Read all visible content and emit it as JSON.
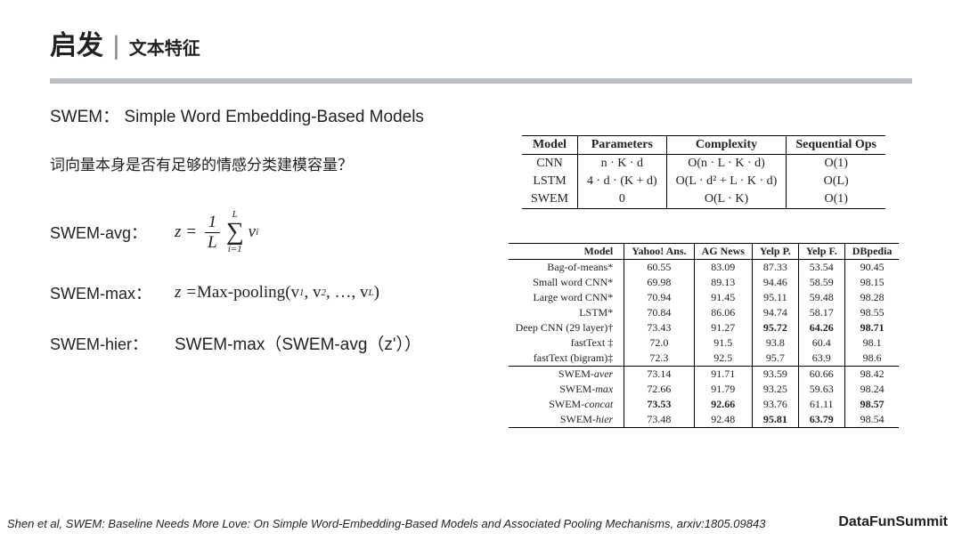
{
  "header": {
    "main": "启发",
    "separator": "|",
    "sub": "文本特征"
  },
  "swem_label": "SWEM：",
  "swem_def": "Simple Word Embedding-Based Models",
  "question": "词向量本身是否有足够的情感分类建模容量？",
  "formulas": {
    "avg": {
      "label": "SWEM-avg：",
      "z": "z",
      "eq": "=",
      "top": "1",
      "bot": "L",
      "sum_top": "L",
      "sum_bot": "i=1",
      "vi": "v",
      "visub": "i"
    },
    "max": {
      "label": "SWEM-max：",
      "text_prefix": "z = ",
      "text_fn": "Max-pooling",
      "text_args": "(v",
      "sub1": "1",
      "c1": ", v",
      "sub2": "2",
      "c2": ", …, v",
      "subL": "L",
      "close": ")"
    },
    "hier": {
      "label": "SWEM-hier：",
      "text": "SWEM-max（SWEM-avg（z'））"
    }
  },
  "table1": {
    "headers": [
      "Model",
      "Parameters",
      "Complexity",
      "Sequential Ops"
    ],
    "rows": [
      [
        "CNN",
        "n · K · d",
        "O(n · L · K · d)",
        "O(1)"
      ],
      [
        "LSTM",
        "4 · d · (K + d)",
        "O(L · d² + L · K · d)",
        "O(L)"
      ],
      [
        "SWEM",
        "0",
        "O(L · K)",
        "O(1)"
      ]
    ]
  },
  "table2": {
    "headers": [
      "Model",
      "Yahoo! Ans.",
      "AG News",
      "Yelp P.",
      "Yelp F.",
      "DBpedia"
    ],
    "rows": [
      {
        "cells": [
          "Bag-of-means*",
          "60.55",
          "83.09",
          "87.33",
          "53.54",
          "90.45"
        ],
        "bold": []
      },
      {
        "cells": [
          "Small word CNN*",
          "69.98",
          "89.13",
          "94.46",
          "58.59",
          "98.15"
        ],
        "bold": []
      },
      {
        "cells": [
          "Large word CNN*",
          "70.94",
          "91.45",
          "95.11",
          "59.48",
          "98.28"
        ],
        "bold": []
      },
      {
        "cells": [
          "LSTM*",
          "70.84",
          "86.06",
          "94.74",
          "58.17",
          "98.55"
        ],
        "bold": []
      },
      {
        "cells": [
          "Deep CNN (29 layer)†",
          "73.43",
          "91.27",
          "95.72",
          "64.26",
          "98.71"
        ],
        "bold": [
          3,
          4,
          5
        ]
      },
      {
        "cells": [
          "fastText ‡",
          "72.0",
          "91.5",
          "93.8",
          "60.4",
          "98.1"
        ],
        "bold": []
      },
      {
        "cells": [
          "fastText (bigram)‡",
          "72.3",
          "92.5",
          "95.7",
          "63.9",
          "98.6"
        ],
        "bold": [],
        "groupEnd": true
      },
      {
        "cells": [
          "SWEM-aver",
          "73.14",
          "91.71",
          "93.59",
          "60.66",
          "98.42"
        ],
        "ital": true,
        "bold": []
      },
      {
        "cells": [
          "SWEM-max",
          "72.66",
          "91.79",
          "93.25",
          "59.63",
          "98.24"
        ],
        "ital": true,
        "bold": []
      },
      {
        "cells": [
          "SWEM-concat",
          "73.53",
          "92.66",
          "93.76",
          "61.11",
          "98.57"
        ],
        "ital": true,
        "bold": [
          1,
          2,
          5
        ]
      },
      {
        "cells": [
          "SWEM-hier",
          "73.48",
          "92.48",
          "95.81",
          "63.79",
          "98.54"
        ],
        "ital": true,
        "bold": [
          3,
          4
        ],
        "last": true
      }
    ]
  },
  "footer": {
    "cite": "Shen et al, SWEM: Baseline Needs More Love: On Simple Word-Embedding-Based Models and Associated Pooling Mechanisms, arxiv:1805.09843",
    "brand": "DataFunSummit"
  }
}
